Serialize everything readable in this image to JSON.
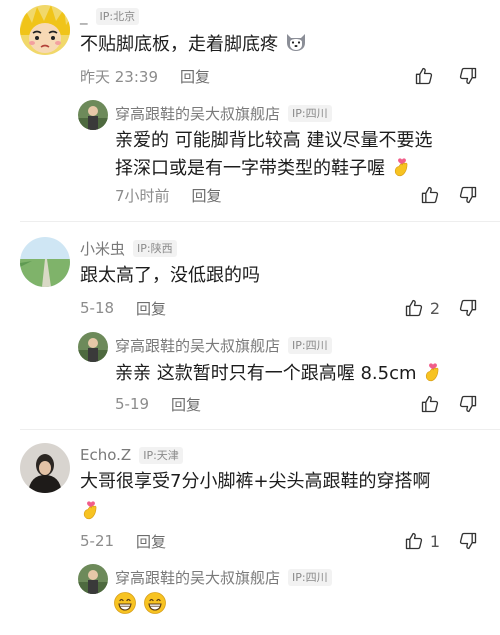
{
  "comments": [
    {
      "username": "_",
      "ip": "IP:北京",
      "text": "不贴脚底板，走着脚底疼",
      "time": "昨天 23:39",
      "reply_label": "回复",
      "likes": "",
      "reply": {
        "username": "穿高跟鞋的吴大叔旗舰店",
        "ip": "IP:四川",
        "text_line1": "亲爱的  可能脚背比较高  建议尽量不要选",
        "text_line2": "择深口或是有一字带类型的鞋子喔",
        "time": "7小时前",
        "reply_label": "回复",
        "likes": ""
      }
    },
    {
      "username": "小米虫",
      "ip": "IP:陕西",
      "text": "跟太高了，没低跟的吗",
      "time": "5-18",
      "reply_label": "回复",
      "likes": "2",
      "reply": {
        "username": "穿高跟鞋的吴大叔旗舰店",
        "ip": "IP:四川",
        "text_line1": "亲亲  这款暂时只有一个跟高喔  8.5cm",
        "time": "5-19",
        "reply_label": "回复",
        "likes": ""
      }
    },
    {
      "username": "Echo.Z",
      "ip": "IP:天津",
      "text": "大哥很享受7分小脚裤+尖头高跟鞋的穿搭啊",
      "time": "5-21",
      "reply_label": "回复",
      "likes": "1",
      "reply": {
        "username": "穿高跟鞋的吴大叔旗舰店",
        "ip": "IP:四川",
        "text_line1": ""
      }
    }
  ],
  "icons": {
    "like": "thumbs-up-outline-icon",
    "dislike": "thumbs-down-outline-icon",
    "emoji_heart": "crossed-fingers-heart-emoji",
    "emoji_grin": "grinning-face-emoji",
    "emoji_husky": "husky-face-emoji"
  },
  "colors": {
    "text": "#1c1c1c",
    "secondary": "#8c8c8c",
    "emoji_yellow": "#f7c322",
    "heart_pink": "#f15d8a"
  }
}
